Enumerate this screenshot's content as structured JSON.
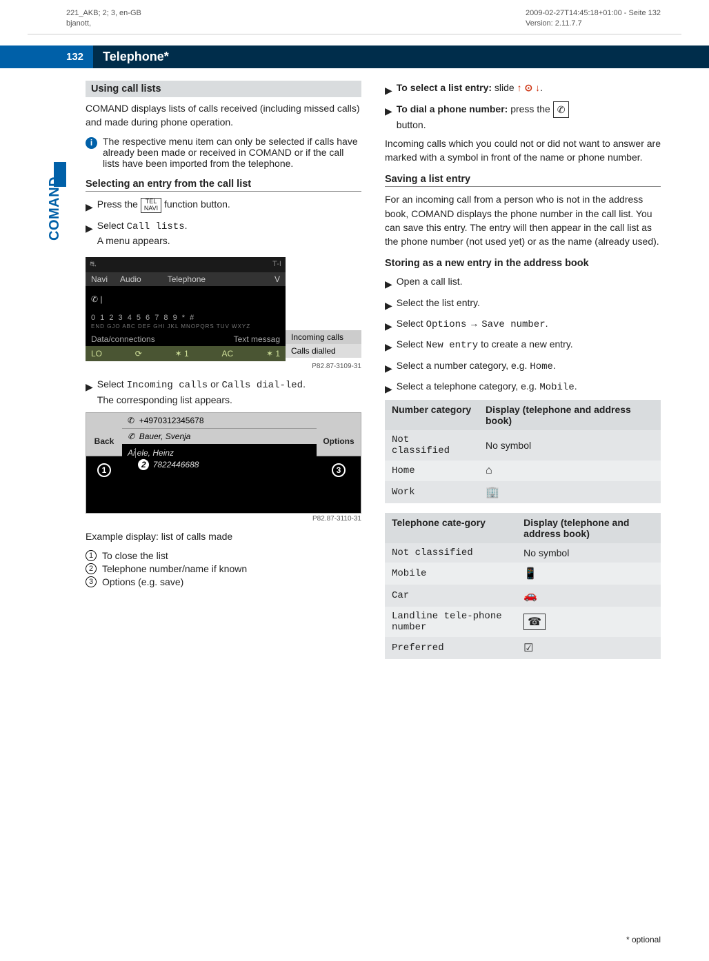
{
  "meta": {
    "topLeft1": "221_AKB; 2; 3, en-GB",
    "topLeft2": "bjanott,",
    "topRight1": "2009-02-27T14:45:18+01:00 - Seite 132",
    "topRight2": "Version: 2.11.7.7"
  },
  "pageNumber": "132",
  "sectionTitle": "Telephone*",
  "sideLabel": "COMAND",
  "left": {
    "h_usingCallLists": "Using call lists",
    "p_comand": "COMAND displays lists of calls received (including missed calls) and made during phone operation.",
    "infoNote": "The respective menu item can only be selected if calls have already been made or received in COMAND or if the call lists have been imported from the telephone.",
    "h_selecting": "Selecting an entry from the call list",
    "step_pressPre": "Press the ",
    "step_pressBtn": "TEL\nNAVI",
    "step_pressPost": " function button.",
    "step_selectCall": "Select ",
    "step_callListsMono": "Call lists",
    "step_callListsPost": ".",
    "step_menuAppears": "A menu appears.",
    "ss1": {
      "tabNavi": "Navi",
      "tabAudio": "Audio",
      "tabTel": "Telephone",
      "tabV": "V",
      "nums": "0  1  2  3  4  5  6  7  8  9  *  #",
      "abc": "END    GJO  ABC  DEF  GHI  JKL  MNOPQRS TUV WXYZ",
      "dataConn": "Data/connections",
      "textMsg": "Text messag",
      "incoming": "Incoming calls",
      "callsDialled": "Calls dialled",
      "lo": "LO",
      "ac": "AC",
      "imgId": "P82.87-3109-31"
    },
    "step_selectIncPre": "Select ",
    "step_incMono": "Incoming calls",
    "step_or": " or ",
    "step_dialMono": "Calls dial-led",
    "step_incPost": ".",
    "step_corresponding": "The corresponding list appears.",
    "ss2": {
      "back": "Back",
      "options": "Options",
      "topNum": "+4970312345678",
      "bauer": "Bauer, Svenja",
      "ai": "Ai",
      "ele": "ele, Heinz",
      "num2": "7822446688",
      "imgId": "P82.87-3110-31"
    },
    "exampleCaption": "Example display: list of calls made",
    "legend1": "To close the list",
    "legend2": "Telephone number/name if known",
    "legend3": "Options (e.g. save)"
  },
  "right": {
    "step_toSelect": "To select a list entry:",
    "step_slide": " slide ",
    "step_toDial": "To dial a phone number:",
    "step_press": " press the ",
    "step_button": "button.",
    "p_incoming": "Incoming calls which you could not or did not want to answer are marked with a symbol in front of the name or phone number.",
    "h_saving": "Saving a list entry",
    "p_saving": "For an incoming call from a person who is not in the address book, COMAND displays the phone number in the call list. You can save this entry. The entry will then appear in the call list as the phone number (not used yet) or as the name (already used).",
    "h_storing": "Storing as a new entry in the address book",
    "steps": {
      "open": "Open a call list.",
      "selectEntry": "Select the list entry.",
      "selectOptPre": "Select ",
      "optMono": "Options",
      "arrow": " → ",
      "saveMono": "Save number",
      "period": ".",
      "selectNewPre": "Select ",
      "newMono": "New entry",
      "newPost": " to create a new entry.",
      "selectNumCat": "Select a number category, e.g. ",
      "homeMono": "Home",
      "selectTelCat": "Select a telephone category, e.g. ",
      "mobileMono": "Mobile"
    },
    "table1": {
      "th1": "Number category",
      "th2": "Display (telephone and address book)",
      "r1c1": "Not classified",
      "r1c2": "No symbol",
      "r2c1": "Home",
      "r3c1": "Work"
    },
    "table2": {
      "th1": "Telephone cate-gory",
      "th2": "Display (telephone and address book)",
      "r1c1": "Not classified",
      "r1c2": "No symbol",
      "r2c1": "Mobile",
      "r3c1": "Car",
      "r4c1": "Landline tele-phone number",
      "r5c1": "Preferred"
    }
  },
  "footnote": "* optional"
}
